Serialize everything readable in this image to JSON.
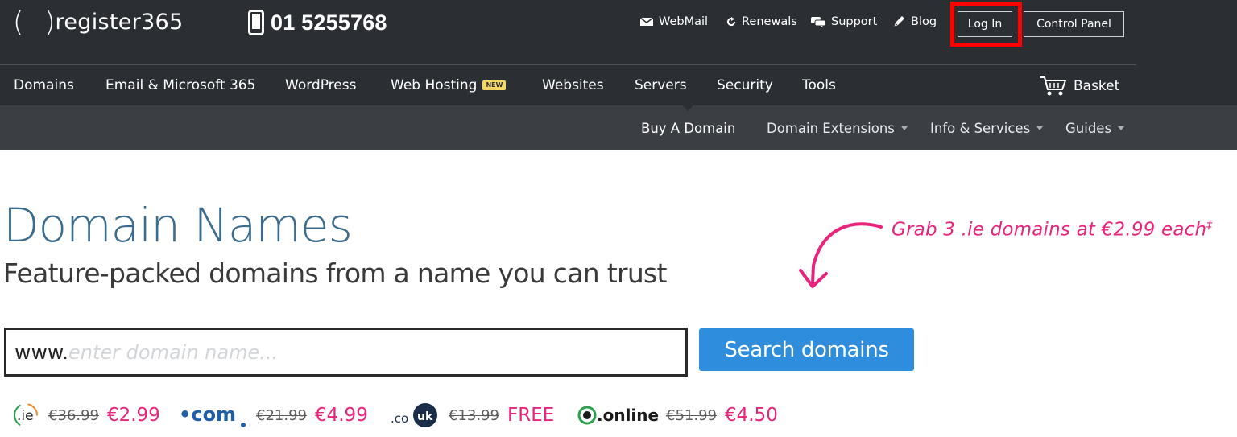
{
  "brand": {
    "name": "register365",
    "phone": "01 5255768"
  },
  "utility": {
    "webmail": "WebMail",
    "renewals": "Renewals",
    "support": "Support",
    "blog": "Blog",
    "login": "Log In",
    "control_panel": "Control Panel"
  },
  "main_nav": {
    "items": [
      "Domains",
      "Email & Microsoft 365",
      "WordPress",
      "Web Hosting",
      "Websites",
      "Servers",
      "Security",
      "Tools"
    ],
    "new_badge": "NEW",
    "basket": "Basket"
  },
  "sub_nav": {
    "items": [
      "Buy A Domain",
      "Domain Extensions",
      "Info & Services",
      "Guides"
    ]
  },
  "hero": {
    "title": "Domain Names",
    "subtitle": "Feature-packed domains from a name you can trust",
    "promo": "Grab 3 .ie domains at €2.99 each",
    "promo_mark": "‡"
  },
  "search": {
    "prefix": "www.",
    "placeholder": "enter domain name...",
    "value": "",
    "button": "Search domains"
  },
  "prices": [
    {
      "tld": ".ie",
      "old": "€36.99",
      "new": "€2.99"
    },
    {
      "tld": ".com",
      "old": "€21.99",
      "new": "€4.99"
    },
    {
      "tld": ".co.uk",
      "old": "€13.99",
      "new": "FREE"
    },
    {
      "tld": ".online",
      "old": "€51.99",
      "new": "€4.50"
    }
  ],
  "colors": {
    "header_bg": "#2b2f34",
    "subbar_bg": "#3b3e43",
    "title_blue": "#3b6c8e",
    "accent_pink": "#e8247d",
    "button_blue": "#2e8ddd",
    "highlight_red": "#ff0000"
  }
}
